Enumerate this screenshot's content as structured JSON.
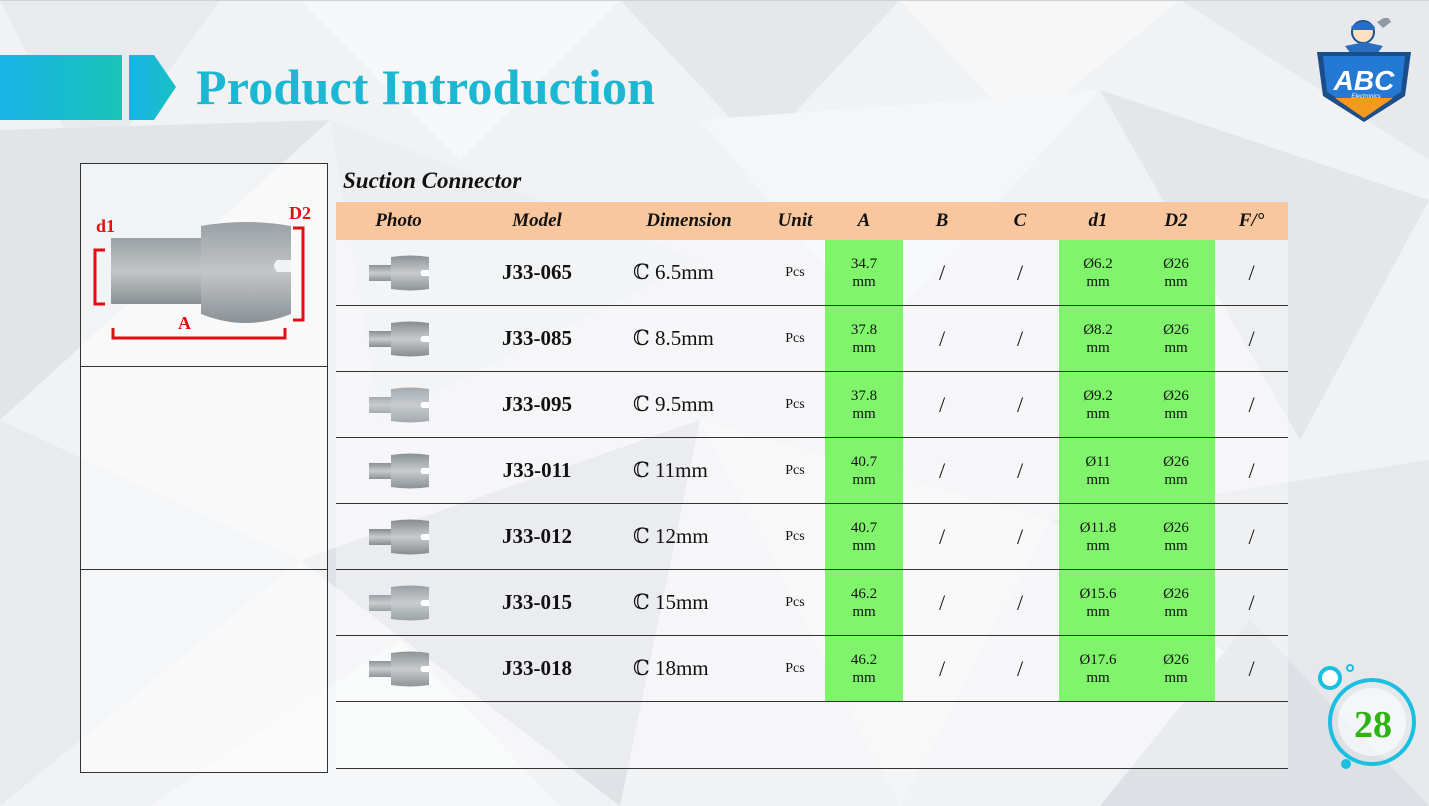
{
  "header": {
    "title": "Product Introduction"
  },
  "logo": {
    "text": "ABC",
    "subtext": "Electronics"
  },
  "diagram": {
    "label_d1": "d1",
    "label_d2": "D2",
    "label_a": "A"
  },
  "table": {
    "title": "Suction Connector",
    "columns": [
      "Photo",
      "Model",
      "Dimension",
      "Unit",
      "A",
      "B",
      "C",
      "d1",
      "D2",
      "F/°"
    ],
    "rows": [
      {
        "model": "J33-065",
        "dimension": "ℂ 6.5mm",
        "unit": "Pcs",
        "a1": "34.7",
        "a2": "mm",
        "b": "/",
        "c": "/",
        "d1a": "Ø6.2",
        "d1b": "mm",
        "d2a": "Ø26",
        "d2b": "mm",
        "f": "/"
      },
      {
        "model": "J33-085",
        "dimension": "ℂ 8.5mm",
        "unit": "Pcs",
        "a1": "37.8",
        "a2": "mm",
        "b": "/",
        "c": "/",
        "d1a": "Ø8.2",
        "d1b": "mm",
        "d2a": "Ø26",
        "d2b": "mm",
        "f": "/"
      },
      {
        "model": "J33-095",
        "dimension": "ℂ 9.5mm",
        "unit": "Pcs",
        "a1": "37.8",
        "a2": "mm",
        "b": "/",
        "c": "/",
        "d1a": "Ø9.2",
        "d1b": "mm",
        "d2a": "Ø26",
        "d2b": "mm",
        "f": "/"
      },
      {
        "model": "J33-011",
        "dimension": "ℂ 11mm",
        "unit": "Pcs",
        "a1": "40.7",
        "a2": "mm",
        "b": "/",
        "c": "/",
        "d1a": "Ø11",
        "d1b": "mm",
        "d2a": "Ø26",
        "d2b": "mm",
        "f": "/"
      },
      {
        "model": "J33-012",
        "dimension": "ℂ 12mm",
        "unit": "Pcs",
        "a1": "40.7",
        "a2": "mm",
        "b": "/",
        "c": "/",
        "d1a": "Ø11.8",
        "d1b": "mm",
        "d2a": "Ø26",
        "d2b": "mm",
        "f": "/"
      },
      {
        "model": "J33-015",
        "dimension": "ℂ 15mm",
        "unit": "Pcs",
        "a1": "46.2",
        "a2": "mm",
        "b": "/",
        "c": "/",
        "d1a": "Ø15.6",
        "d1b": "mm",
        "d2a": "Ø26",
        "d2b": "mm",
        "f": "/"
      },
      {
        "model": "J33-018",
        "dimension": "ℂ 18mm",
        "unit": "Pcs",
        "a1": "46.2",
        "a2": "mm",
        "b": "/",
        "c": "/",
        "d1a": "Ø17.6",
        "d1b": "mm",
        "d2a": "Ø26",
        "d2b": "mm",
        "f": "/"
      }
    ]
  },
  "page": {
    "number": "28"
  },
  "colors": {
    "accent": "#1bb7d3",
    "header_fill": "#f8c79e",
    "highlight": "#80f56b",
    "dim_red": "#e01010",
    "page_green": "#2db314"
  }
}
